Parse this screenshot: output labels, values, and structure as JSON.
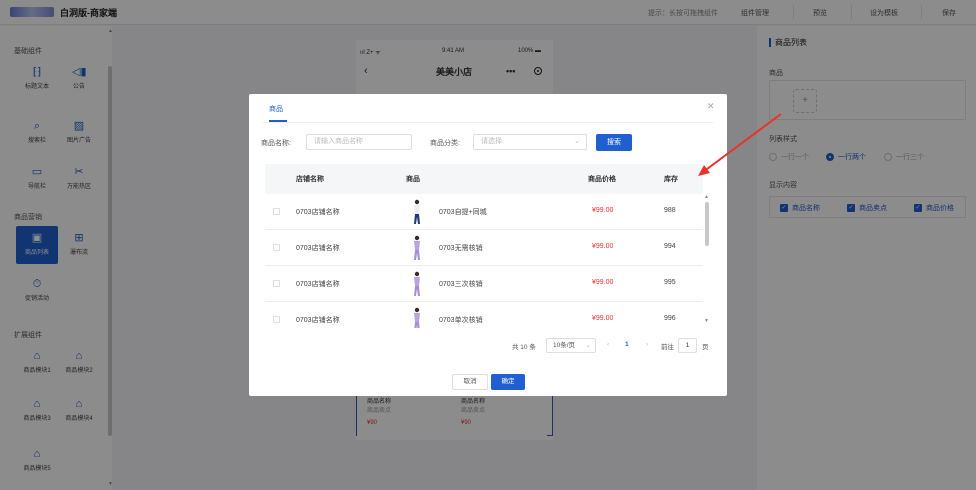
{
  "topbar": {
    "title": "白洞版-商家端",
    "tip": "提示：长按可拖拽组件",
    "buttons": [
      "组件管理",
      "预览",
      "设为模板",
      "保存"
    ]
  },
  "sidebar": {
    "groups": [
      {
        "title": "基础组件",
        "items": [
          {
            "label": "标题文本",
            "icon": "title-text-icon"
          },
          {
            "label": "公告",
            "icon": "announcement-icon"
          },
          {
            "label": "搜索栏",
            "icon": "search-bar-icon"
          },
          {
            "label": "图片广告",
            "icon": "image-ad-icon"
          },
          {
            "label": "导航栏",
            "icon": "navbar-icon"
          },
          {
            "label": "万能热区",
            "icon": "hotspot-icon"
          }
        ]
      },
      {
        "title": "商品营销",
        "items": [
          {
            "label": "商品列表",
            "icon": "product-list-icon",
            "active": true
          },
          {
            "label": "瀑布流",
            "icon": "waterfall-icon"
          },
          {
            "label": "促销活动",
            "icon": "promotion-icon"
          }
        ]
      },
      {
        "title": "扩展组件",
        "items": [
          {
            "label": "商品模块1",
            "icon": "module-icon"
          },
          {
            "label": "商品模块2",
            "icon": "module-icon"
          },
          {
            "label": "商品模块3",
            "icon": "module-icon"
          },
          {
            "label": "商品模块4",
            "icon": "module-icon"
          },
          {
            "label": "商品模块5",
            "icon": "module-icon"
          }
        ]
      }
    ]
  },
  "phone": {
    "signal": "ııl Z+ ᯤ",
    "time": "9:41 AM",
    "battery": "100% ▬",
    "title": "美美小店",
    "cards": [
      {
        "name": "商品名称",
        "sell": "商品卖点",
        "price": "¥90"
      },
      {
        "name": "商品名称",
        "sell": "商品卖点",
        "price": "¥90"
      }
    ]
  },
  "right_panel": {
    "title": "商品列表",
    "product_label": "商品",
    "style_label": "列表样式",
    "styles": [
      {
        "label": "一行一个",
        "selected": false
      },
      {
        "label": "一行两个",
        "selected": true
      },
      {
        "label": "一行三个",
        "selected": false
      }
    ],
    "display_label": "显示内容",
    "display_items": [
      "商品名称",
      "商品卖点",
      "商品价格"
    ]
  },
  "dialog": {
    "tab": "商品",
    "name_label": "商品名称:",
    "name_placeholder": "请输入商品名称",
    "category_label": "商品分类:",
    "category_placeholder": "请选择",
    "search_button": "搜索",
    "columns": [
      "店铺名称",
      "商品",
      "商品价格",
      "库存"
    ],
    "rows": [
      {
        "shop": "0703店铺名称",
        "goods": "0703自提+同城",
        "price": "¥99.00",
        "stock": "988"
      },
      {
        "shop": "0703店铺名称",
        "goods": "0703无需核销",
        "price": "¥99.00",
        "stock": "994"
      },
      {
        "shop": "0703店铺名称",
        "goods": "0703三次核销",
        "price": "¥99.00",
        "stock": "995"
      },
      {
        "shop": "0703店铺名称",
        "goods": "0703单次核销",
        "price": "¥99.00",
        "stock": "996"
      }
    ],
    "pagination": {
      "total": "共 10 条",
      "page_size": "10条/页",
      "current": "1",
      "goto": "前往",
      "goto_value": "1",
      "page_unit": "页"
    },
    "cancel": "取消",
    "ok": "确定"
  },
  "colors": {
    "accent": "#1f5fd0",
    "price": "#ee3333",
    "arrow": "#e8332a"
  }
}
